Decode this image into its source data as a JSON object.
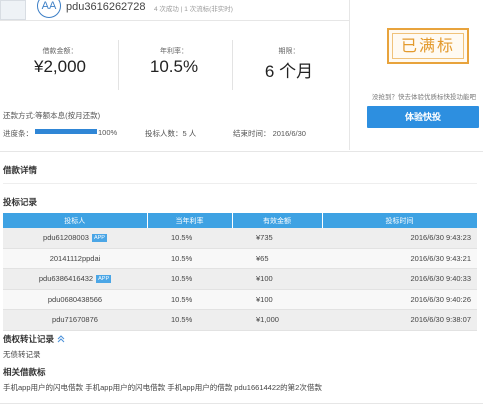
{
  "header": {
    "avatar_initials": "AA",
    "username": "pdu3616262728",
    "meta": "4 次成功 | 1 次流标(非实时)"
  },
  "stats": [
    {
      "label": "借款金额：",
      "value": "¥2,000"
    },
    {
      "label": "年利率：",
      "value": "10.5%"
    },
    {
      "label": "期限：",
      "value": "6 个月"
    }
  ],
  "status_stamp": "已满标",
  "notice_text": "没抢到？快去体验优质标快投功能吧",
  "cta_label": "体验快投",
  "repayment": "还款方式:等额本息(按月还款)",
  "progress": {
    "label": "进度条：",
    "percent_text": "100%",
    "fraction": 1.0
  },
  "bidders": "投标人数：5 人",
  "end_time": "结束时间： 2016/6/30",
  "sections": {
    "loan_detail": "借款详情",
    "bid_records": "投标记录",
    "transfer_records": "债权转让记录",
    "no_transfer": "无债转记录",
    "related": "相关借款标"
  },
  "bids_table": {
    "headers": [
      "投标人",
      "当年利率",
      "有效金额",
      "投标时间"
    ],
    "rows": [
      {
        "bidder": "pdu61208003",
        "app": "APP",
        "rate": "10.5%",
        "amount": "¥735",
        "time": "2016/6/30 9:43:23"
      },
      {
        "bidder": "20141112ppdai",
        "app": "",
        "rate": "10.5%",
        "amount": "¥65",
        "time": "2016/6/30 9:43:21"
      },
      {
        "bidder": "pdu6386416432",
        "app": "APP",
        "rate": "10.5%",
        "amount": "¥100",
        "time": "2016/6/30 9:40:33"
      },
      {
        "bidder": "pdu0680438566",
        "app": "",
        "rate": "10.5%",
        "amount": "¥100",
        "time": "2016/6/30 9:40:26"
      },
      {
        "bidder": "pdu71670876",
        "app": "",
        "rate": "10.5%",
        "amount": "¥1,000",
        "time": "2016/6/30 9:38:07"
      }
    ]
  },
  "related_text": "手机app用户的闪电借款 手机app用户的闪电借款 手机app用户的借款 pdu16614422的第2次借款",
  "colors": {
    "accent": "#2d8fe0",
    "table_header": "#3ea2e3",
    "stamp": "#e39a2d"
  }
}
